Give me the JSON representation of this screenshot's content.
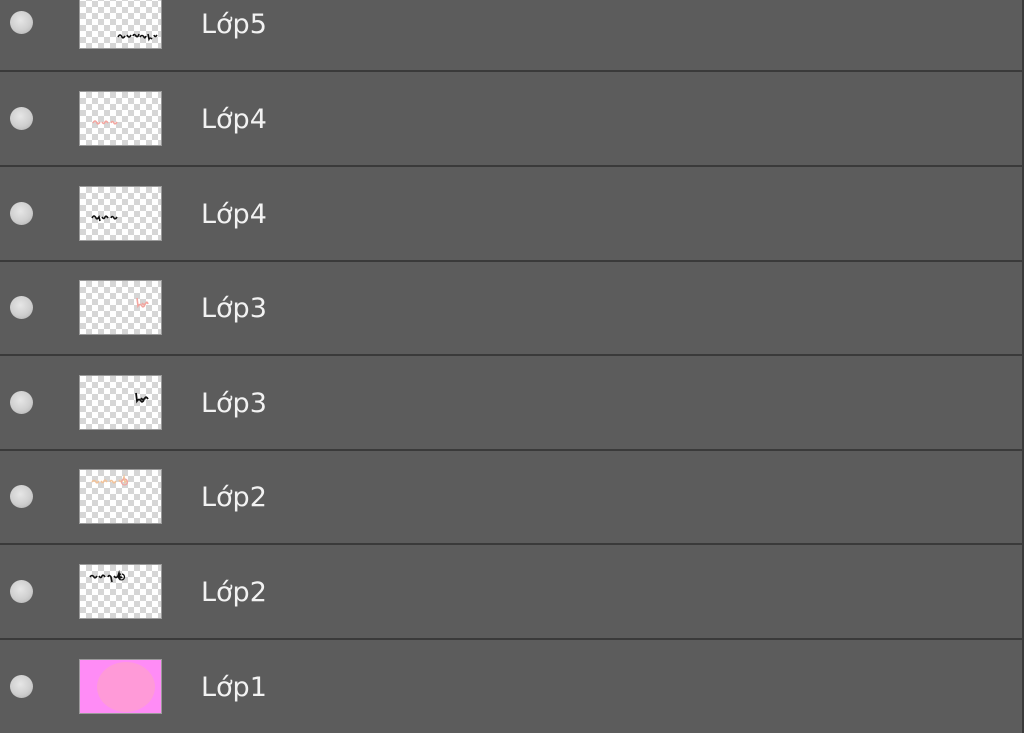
{
  "layers_panel": {
    "layers": [
      {
        "name": "Lớp5",
        "thumbnail": "black-handwriting-right"
      },
      {
        "name": "Lớp4",
        "thumbnail": "pink-handwriting-left"
      },
      {
        "name": "Lớp4",
        "thumbnail": "black-handwriting-left"
      },
      {
        "name": "Lớp3",
        "thumbnail": "pink-handwriting-right"
      },
      {
        "name": "Lớp3",
        "thumbnail": "black-handwriting-right"
      },
      {
        "name": "Lớp2",
        "thumbnail": "pink-handwriting-top"
      },
      {
        "name": "Lớp2",
        "thumbnail": "black-handwriting-top"
      },
      {
        "name": "Lớp1",
        "thumbnail": "pink-circle-on-magenta"
      }
    ],
    "colors": {
      "panel_bg": "#5c5c5c",
      "divider": "#3a3a3a",
      "text": "#f2f2f2",
      "visibility_dot": "#d0d0d0",
      "background_layer_fill": "#ff8cf6",
      "background_layer_circle": "#ff9ad8"
    }
  }
}
